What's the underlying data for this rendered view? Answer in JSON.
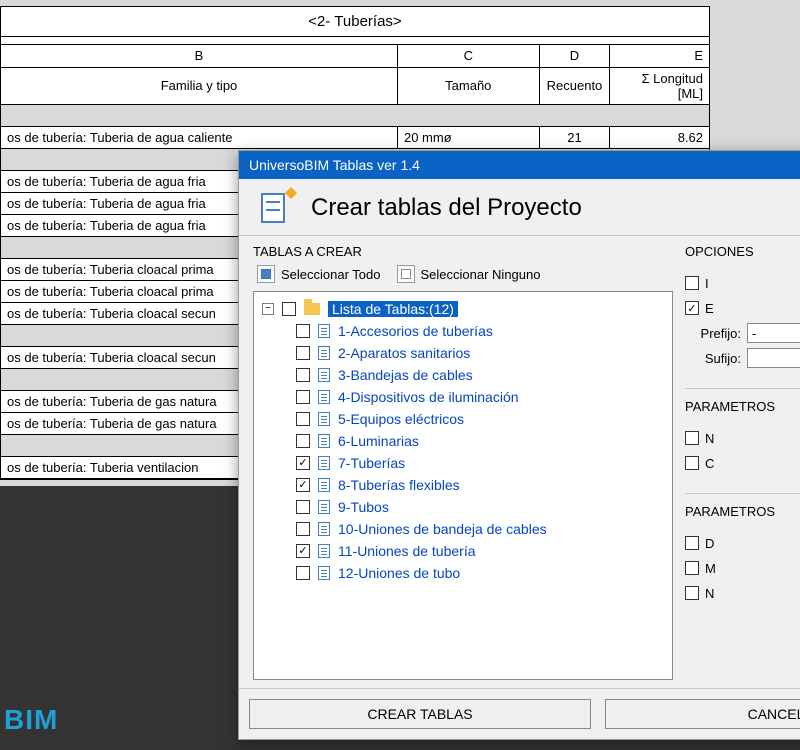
{
  "sheet": {
    "title": "<2- Tuberías>",
    "columns": {
      "b": "B",
      "c": "C",
      "d": "D",
      "e": "E"
    },
    "headers": {
      "b": "Familia y tipo",
      "c": "Tamaño",
      "d": "Recuento",
      "e": "Σ Longitud [ML]"
    },
    "row_main": {
      "b": "os de tubería: Tuberia de agua caliente",
      "c": "20 mmø",
      "d": "21",
      "e": "8.62"
    },
    "rows_partial": [
      "os de tubería: Tuberia de agua fria",
      "os de tubería: Tuberia de agua fria",
      "os de tubería: Tuberia de agua fria",
      "SPACER",
      "os de tubería: Tuberia cloacal prima",
      "os de tubería: Tuberia cloacal prima",
      "os de tubería: Tuberia cloacal secun",
      "SPACER",
      "os de tubería: Tuberia cloacal secun",
      "SPACER",
      "os de tubería: Tuberia de gas natura",
      "os de tubería: Tuberia de gas natura",
      "SPACER",
      "os de tubería: Tuberia ventilacion"
    ]
  },
  "brand": "BIM",
  "dialog": {
    "window_title": "UniversoBIM Tablas ver 1.4",
    "header": "Crear tablas del Proyecto",
    "tablas_a_crear": "TABLAS A CREAR",
    "seleccionar_todo": "Seleccionar Todo",
    "seleccionar_ninguno": "Seleccionar Ninguno",
    "root_label": "Lista de Tablas:(12)",
    "items": [
      {
        "label": "1-Accesorios de tuberías",
        "checked": false
      },
      {
        "label": "2-Aparatos sanitarios",
        "checked": false
      },
      {
        "label": "3-Bandejas de cables",
        "checked": false
      },
      {
        "label": "4-Dispositivos de iluminación",
        "checked": false
      },
      {
        "label": "5-Equipos eléctricos",
        "checked": false
      },
      {
        "label": "6-Luminarias",
        "checked": false
      },
      {
        "label": "7-Tuberías",
        "checked": true
      },
      {
        "label": "8-Tuberías flexibles",
        "checked": true
      },
      {
        "label": "9-Tubos",
        "checked": false
      },
      {
        "label": "10-Uniones de bandeja de cables",
        "checked": false
      },
      {
        "label": "11-Uniones de tubería",
        "checked": true
      },
      {
        "label": "12-Uniones de tubo",
        "checked": false
      }
    ],
    "opciones_hdr": "OPCIONES",
    "option_checkbox_1_partial": "I",
    "option_checkbox_2_partial": "E",
    "prefijo_label": "Prefijo:",
    "prefijo_value": "-",
    "sufijo_label": "Sufijo:",
    "sufijo_value": "",
    "parametros_1": "PARAMETROS",
    "param1_a": "N",
    "param1_b": "C",
    "parametros_2": "PARAMETROS",
    "param2_a": "D",
    "param2_b": "M",
    "param2_c": "N",
    "btn_crear": "CREAR TABLAS",
    "btn_cancel": "CANCEL"
  }
}
